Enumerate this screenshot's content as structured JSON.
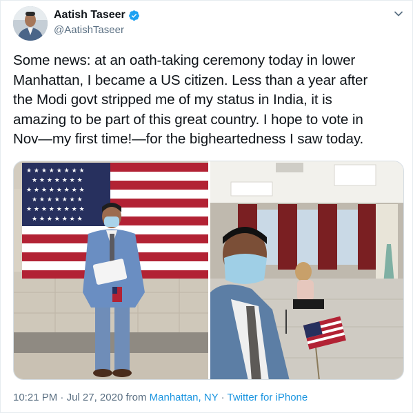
{
  "tweet": {
    "display_name": "Aatish Taseer",
    "handle": "@AatishTaseer",
    "verified": true,
    "text": "Some news: at an oath-taking ceremony today in lower\nManhattan, I became a US citizen. Less than a year after\nthe Modi govt stripped me of my status in India, it is\namazing to be part of this great country. I hope to vote in\nNov—my first time!—for the bigheartedness I saw today.",
    "time": "10:21 PM",
    "separator": " · ",
    "date": "Jul 27, 2020",
    "from_label": " from ",
    "location": "Manhattan, NY",
    "separator2": " · ",
    "source": "Twitter for iPhone"
  },
  "icons": {
    "verified": "verified-badge-icon",
    "menu": "chevron-down-icon"
  },
  "colors": {
    "link": "#1b95e0",
    "secondary_text": "#5b7083",
    "verified_blue": "#1da1f2"
  }
}
